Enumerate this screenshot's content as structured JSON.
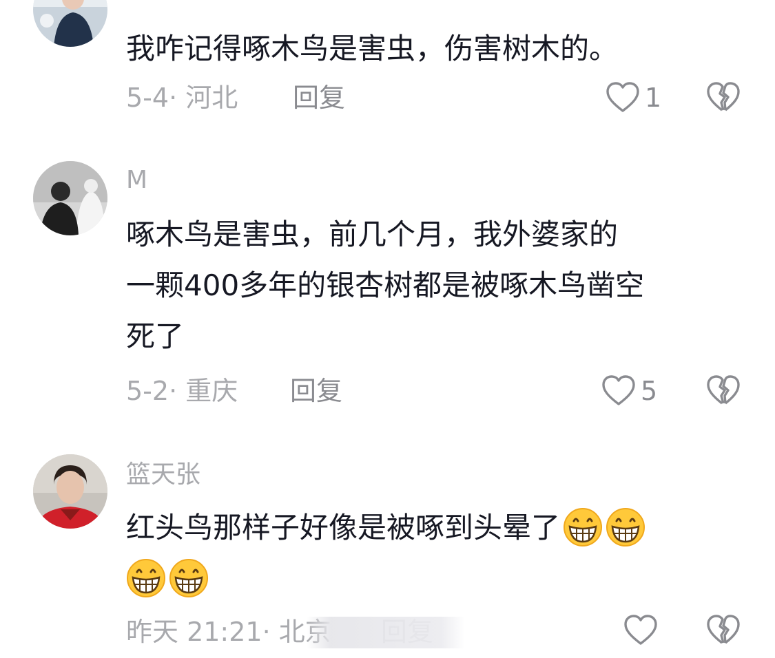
{
  "comments": [
    {
      "username": "",
      "text_lines": [
        "我咋记得啄木鸟是害虫，伤害树木的。"
      ],
      "date": "5-4",
      "location": "河北",
      "reply_label": "回复",
      "likes": "1"
    },
    {
      "username": "M",
      "text_lines": [
        "啄木鸟是害虫，前几个月，我外婆家的",
        "一颗400多年的银杏树都是被啄木鸟凿空",
        "死了"
      ],
      "date": "5-2",
      "location": "重庆",
      "reply_label": "回复",
      "likes": "5"
    },
    {
      "username": "篮天张",
      "text_lines": [
        "红头鸟那样子好像是被啄到头晕了",
        ""
      ],
      "emoji_name": "grinning-face-emoji",
      "date": "昨天 21:21",
      "location": "北京",
      "reply_label": "回复",
      "likes": ""
    }
  ],
  "icons": {
    "like": "heart-outline-icon",
    "dislike": "broken-heart-icon"
  },
  "colors": {
    "text": "#161823",
    "meta": "#a8a9ad",
    "icon": "#8a8b90"
  }
}
